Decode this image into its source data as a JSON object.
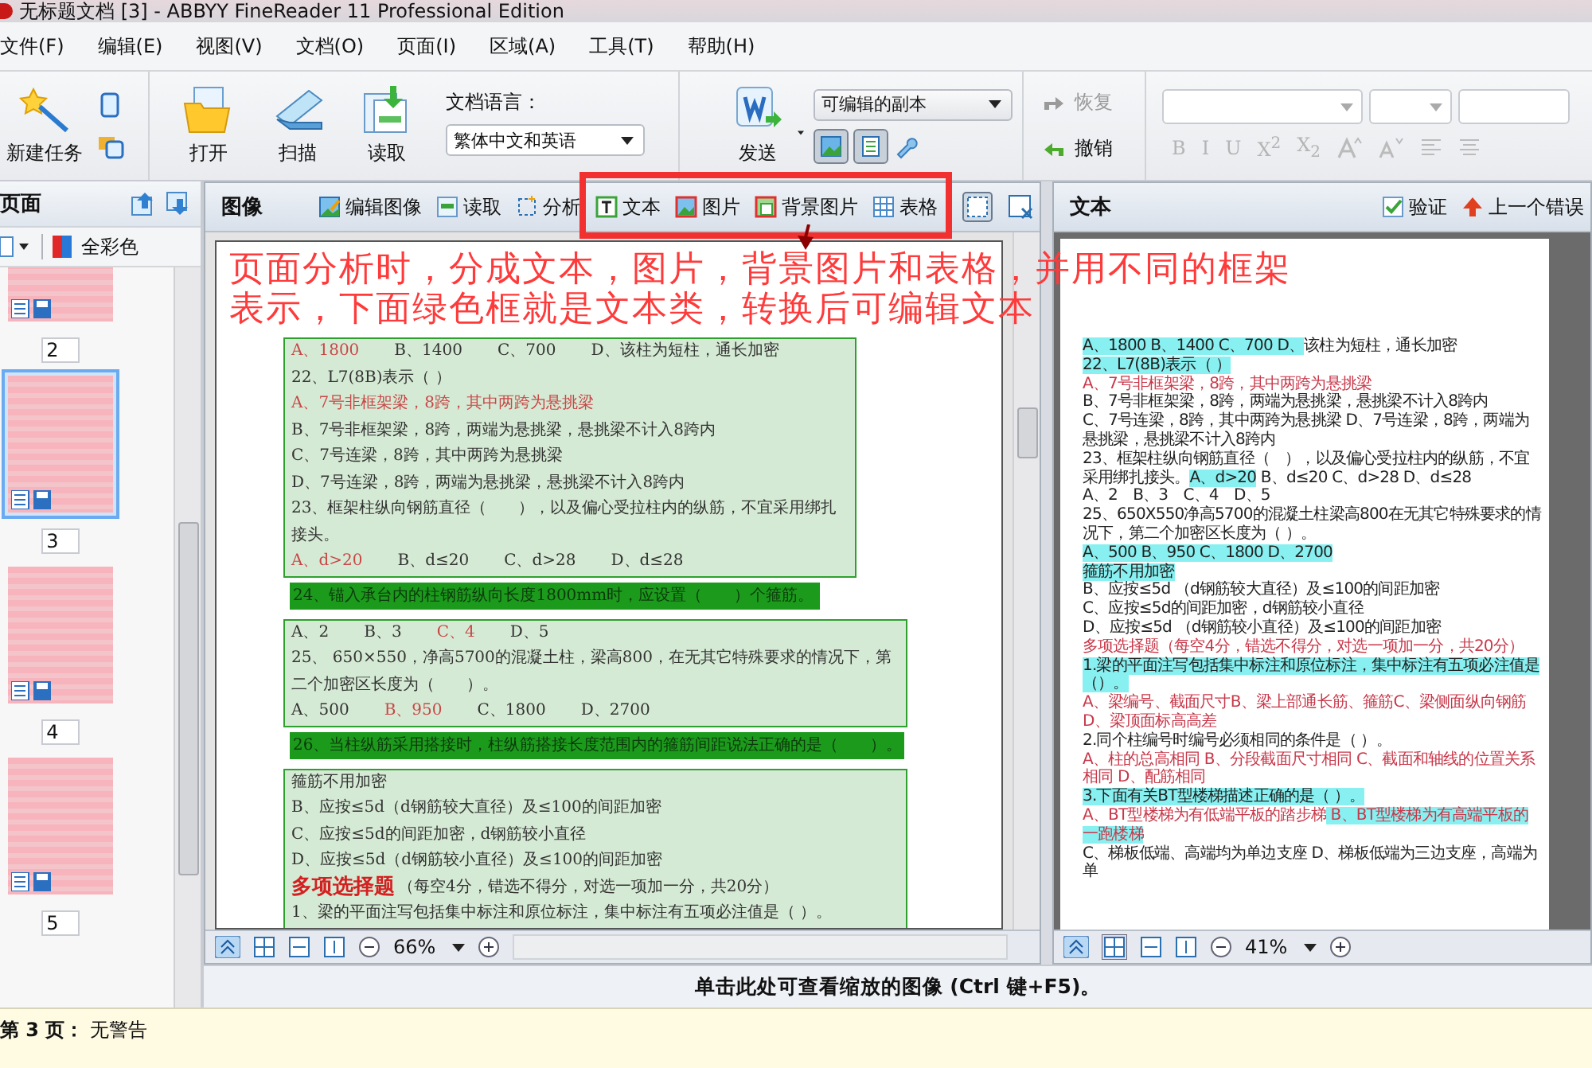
{
  "window": {
    "title": "无标题文档 [3] - ABBYY FineReader 11 Professional Edition"
  },
  "menu": [
    "文件(F)",
    "编辑(E)",
    "视图(V)",
    "文档(O)",
    "页面(I)",
    "区域(A)",
    "工具(T)",
    "帮助(H)"
  ],
  "toolbar": {
    "new_task": "新建任务",
    "open": "打开",
    "scan": "扫描",
    "read": "读取",
    "language": {
      "label": "文档语言：",
      "value": "繁体中文和英语"
    },
    "send": "发送",
    "send_format": "可编辑的副本",
    "view_toggles": [
      {
        "selected": true
      },
      {
        "selected": true
      }
    ],
    "redo": {
      "label": "恢复",
      "disabled": true
    },
    "undo": {
      "label": "撤销",
      "disabled": false
    },
    "format_disabled": true,
    "format_buttons": [
      "B",
      "I",
      "U",
      "X$^{2}$",
      "X$_{2}$"
    ]
  },
  "pages_panel": {
    "title": "页面",
    "color_mode": "全彩色",
    "thumbnails": [
      {
        "number": "2",
        "selected": false
      },
      {
        "number": "3",
        "selected": true
      },
      {
        "number": "4",
        "selected": false
      },
      {
        "number": "5",
        "selected": false
      }
    ]
  },
  "image_pane": {
    "title": "图像",
    "tools": [
      {
        "label": "编辑图像",
        "kind": "edit"
      },
      {
        "label": "读取",
        "kind": "read"
      },
      {
        "label": "分析",
        "kind": "analyze"
      },
      {
        "label": "文本",
        "kind": "text"
      },
      {
        "label": "图片",
        "kind": "picture"
      },
      {
        "label": "背景图片",
        "kind": "background"
      },
      {
        "label": "表格",
        "kind": "table"
      }
    ],
    "zoom": "66%",
    "blocks": [
      {
        "kind": "region",
        "lines": [
          [
            {
              "text": "A、1800",
              "kind": "answer"
            },
            {
              "text": "B、1400",
              "kind": "plain"
            },
            {
              "text": "C、700",
              "kind": "plain"
            },
            {
              "text": "D、该柱为短柱，通长加密",
              "kind": "plain"
            }
          ],
          [
            {
              "text": "22、L7(8B)表示（  ）",
              "kind": "plain"
            }
          ],
          [
            {
              "text": "A、7号非框架梁，8跨，其中两跨为悬挑梁",
              "kind": "answer"
            }
          ],
          [
            {
              "text": "B、7号非框架梁，8跨，两端为悬挑梁，悬挑梁不计入8跨内",
              "kind": "plain"
            }
          ],
          [
            {
              "text": "C、7号连梁，8跨，其中两跨为悬挑梁",
              "kind": "plain"
            }
          ],
          [
            {
              "text": "D、7号连梁，8跨，两端为悬挑梁，悬挑梁不计入8跨内",
              "kind": "plain"
            }
          ],
          [
            {
              "text": "23、框架柱纵向钢筋直径（　　），以及偏心受拉柱内的纵筋，不宜采用绑扎接头。",
              "kind": "plain"
            }
          ],
          [
            {
              "text": "A、d>20",
              "kind": "answer"
            },
            {
              "text": "B、d≤20",
              "kind": "plain"
            },
            {
              "text": "C、d>28",
              "kind": "plain"
            },
            {
              "text": "D、d≤28",
              "kind": "plain"
            }
          ]
        ]
      },
      {
        "kind": "bar",
        "text": "24、锚入承台内的柱钢筋纵向长度1800mm时，应设置（　　）个箍筋。"
      },
      {
        "kind": "region",
        "lines": [
          [
            {
              "text": "A、2",
              "kind": "plain"
            },
            {
              "text": "B、3",
              "kind": "plain"
            },
            {
              "text": "C、4",
              "kind": "answer"
            },
            {
              "text": "D、5",
              "kind": "plain"
            }
          ],
          [
            {
              "text": "25、 650×550，净高5700的混凝土柱，梁高800，在无其它特殊要求的情况下，第二个加密区长度为（　　）。",
              "kind": "plain"
            }
          ],
          [
            {
              "text": "A、500",
              "kind": "plain"
            },
            {
              "text": "B、950",
              "kind": "answer"
            },
            {
              "text": "C、1800",
              "kind": "plain"
            },
            {
              "text": "D、2700",
              "kind": "plain"
            }
          ]
        ]
      },
      {
        "kind": "bar",
        "text": "26、当柱纵筋采用搭接时，柱纵筋搭接长度范围内的箍筋间距说法正确的是（　　）。"
      },
      {
        "kind": "region",
        "lines": [
          [
            {
              "text": "箍筋不用加密",
              "kind": "plain"
            }
          ],
          [
            {
              "text": "B、应按≤5d（d钢筋较大直径）及≤100的间距加密",
              "kind": "plain"
            }
          ],
          [
            {
              "text": "C、应按≤5d的间距加密，d钢筋较小直径",
              "kind": "plain"
            }
          ],
          [
            {
              "text": "D、应按≤5d（d钢筋较小直径）及≤100的间距加密",
              "kind": "plain"
            }
          ],
          [
            {
              "text": "多项选择题",
              "kind": "heading"
            },
            {
              "text": "（每空4分，错选不得分，对选一项加一分，共20分）",
              "kind": "plain"
            }
          ],
          [
            {
              "text": "1、梁的平面注写包括集中标注和原位标注，集中标注有五项必注值是（ ）。",
              "kind": "plain"
            }
          ]
        ]
      }
    ]
  },
  "text_pane": {
    "title": "文本",
    "verify": "验证",
    "prev_error": "上一个错误",
    "zoom": "41%",
    "lines": [
      {
        "kind": "plain",
        "segments": [
          {
            "text": "A、1800 B、1400 C、700 D、",
            "uncertain": true
          },
          {
            "text": "该柱为短柱，通长加密",
            "uncertain": false
          }
        ]
      },
      {
        "kind": "plain",
        "segments": [
          {
            "text": "22、L7(8B)表示（ ）",
            "uncertain": true
          }
        ]
      },
      {
        "kind": "answer",
        "segments": [
          {
            "text": "A、7号非框架梁，8跨，其中两跨为悬挑梁",
            "uncertain": false
          }
        ]
      },
      {
        "kind": "plain",
        "segments": [
          {
            "text": "B、7号非框架梁，8跨，两端为悬挑梁，悬挑梁不计入8跨内",
            "uncertain": false
          }
        ]
      },
      {
        "kind": "plain",
        "segments": [
          {
            "text": "C、7号连梁，8跨，其中两跨为悬挑梁 D、7号连梁，8跨，两端为悬挑梁，悬挑梁不计入8跨内",
            "uncertain": false
          }
        ]
      },
      {
        "kind": "plain",
        "segments": [
          {
            "text": "23、框架柱纵向钢筋直径（　），以及偏心受拉柱内的纵筋，不宜采用绑扎接头。",
            "uncertain": false
          },
          {
            "text": "A、d>20",
            "uncertain": true
          },
          {
            "text": " B、d≤20 C、d>28 D、d≤28",
            "uncertain": false
          }
        ]
      },
      {
        "kind": "plain",
        "segments": [
          {
            "text": "A、2　B、3　C、4　D、5",
            "uncertain": false
          }
        ]
      },
      {
        "kind": "plain",
        "segments": [
          {
            "text": "25、650X550净高5700的混凝土柱梁高800在无其它特殊要求的情况下，第二个加密区长度为（ ）。",
            "uncertain": false
          }
        ]
      },
      {
        "kind": "plain",
        "segments": [
          {
            "text": "A、500 B、950 C、1800 D、2700",
            "uncertain": true
          }
        ]
      },
      {
        "kind": "plain",
        "segments": [
          {
            "text": "箍筋不用加密",
            "uncertain": true
          }
        ]
      },
      {
        "kind": "plain",
        "segments": [
          {
            "text": "B、应按≤5d （d钢筋较大直径）及≤100的间距加密",
            "uncertain": false
          }
        ]
      },
      {
        "kind": "plain",
        "segments": [
          {
            "text": "C、应按≤5d的间距加密，d钢筋较小直径",
            "uncertain": false
          }
        ]
      },
      {
        "kind": "plain",
        "segments": [
          {
            "text": "D、应按≤5d （d钢筋较小直径）及≤100的间距加密",
            "uncertain": false
          }
        ]
      },
      {
        "kind": "answer",
        "segments": [
          {
            "text": "多项选择题（每空4分，错选不得分，对选一项加一分，共20分）",
            "uncertain": false
          }
        ]
      },
      {
        "kind": "plain",
        "segments": [
          {
            "text": "1.梁的平面注写包括集中标注和原位标注，集中标注有五项必注值是（）。",
            "uncertain": true
          }
        ]
      },
      {
        "kind": "answer",
        "segments": [
          {
            "text": "A、梁编号、截面尺寸B、梁上部通长筋、箍筋C、梁侧面纵向钢筋D、梁顶面标高高差",
            "uncertain": false
          }
        ]
      },
      {
        "kind": "plain",
        "segments": [
          {
            "text": "2.同个柱编号时编号必须相同的条件是（ ）。",
            "uncertain": false
          }
        ]
      },
      {
        "kind": "answer",
        "segments": [
          {
            "text": "A、柱的总高相同 B、分段截面尺寸相同 C、截面和轴线的位置关系相同 D、配筋相同",
            "uncertain": false
          }
        ]
      },
      {
        "kind": "plain",
        "segments": [
          {
            "text": "3.下面有关BT型楼梯描述正确的是（ ）。",
            "uncertain": true
          }
        ]
      },
      {
        "kind": "answer",
        "segments": [
          {
            "text": "A、BT型楼梯为有低端平板的踏步梯",
            "uncertain": false
          },
          {
            "text": " B、BT型楼梯为有高端平板的一跑楼梯",
            "uncertain": true
          }
        ]
      },
      {
        "kind": "plain",
        "segments": [
          {
            "text": "C、梯板低端、高端均为单边支座 D、梯板低端为三边支座，高端为单",
            "uncertain": false
          }
        ]
      }
    ]
  },
  "annotation": {
    "text": "页面分析时，分成文本，图片，背景图片和表格，并用不同的框架表示，下面绿色框就是文本类，转换后可编辑文本"
  },
  "zoom_hint": "单击此处可查看缩放的图像 (Ctrl 键+F5)。",
  "status_bar": "**第 3 页：** 无警告"
}
